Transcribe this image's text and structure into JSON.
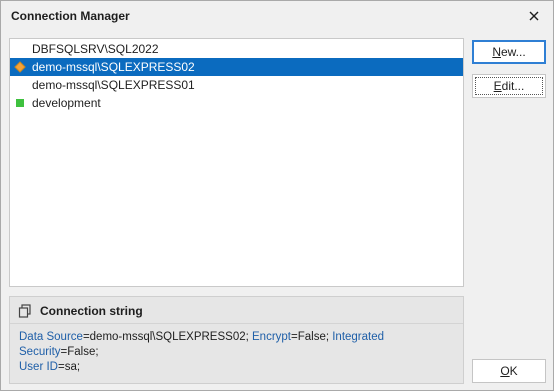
{
  "window": {
    "title": "Connection Manager",
    "close_glyph": "close-icon"
  },
  "connections": [
    {
      "label": "DBFSQLSRV\\SQL2022",
      "marker": "none",
      "selected": false
    },
    {
      "label": "demo-mssql\\SQLEXPRESS02",
      "marker": "diamond",
      "marker_color": "#f2a33a",
      "selected": true
    },
    {
      "label": "demo-mssql\\SQLEXPRESS01",
      "marker": "none",
      "selected": false
    },
    {
      "label": "development",
      "marker": "square",
      "marker_color": "#3ec13e",
      "selected": false
    }
  ],
  "buttons": {
    "new": {
      "mnemonic": "N",
      "rest": "ew..."
    },
    "edit": {
      "mnemonic": "E",
      "rest": "dit..."
    },
    "ok": {
      "mnemonic": "O",
      "rest": "K"
    }
  },
  "connection_string": {
    "title": "Connection string",
    "parts": [
      {
        "key": "Data Source",
        "value": "=demo-mssql\\SQLEXPRESS02; "
      },
      {
        "key": "Encrypt",
        "value": "=False; "
      },
      {
        "key": "Integrated Security",
        "value": "=False; "
      },
      {
        "key": "User ID",
        "value": "=sa;"
      }
    ]
  },
  "colors": {
    "selection": "#0b6bbf",
    "key_text": "#1f5fa8"
  }
}
